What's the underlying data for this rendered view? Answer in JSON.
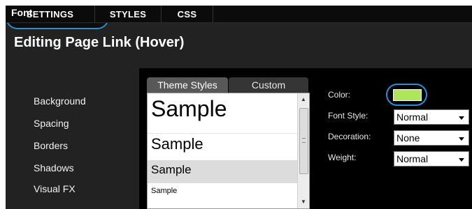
{
  "nav": {
    "tabs": [
      "SETTINGS",
      "STYLES",
      "CSS"
    ]
  },
  "heading": "Editing Page Link (Hover)",
  "sidebar": {
    "items": [
      "Font",
      "Background",
      "Spacing",
      "Borders",
      "Shadows",
      "Visual FX"
    ]
  },
  "panel": {
    "tabs": [
      "Theme Styles",
      "Custom"
    ],
    "samples": [
      "Sample",
      "Sample",
      "Sample",
      "Sample"
    ],
    "selected_sample_index": 2
  },
  "properties": {
    "color_label": "Color:",
    "color_value": "#aee55b",
    "font_style_label": "Font Style:",
    "font_style_value": "Normal",
    "decoration_label": "Decoration:",
    "decoration_value": "None",
    "weight_label": "Weight:",
    "weight_value": "Normal"
  },
  "colors": {
    "highlight_ring": "#2b8fd6",
    "background": "#222222"
  }
}
